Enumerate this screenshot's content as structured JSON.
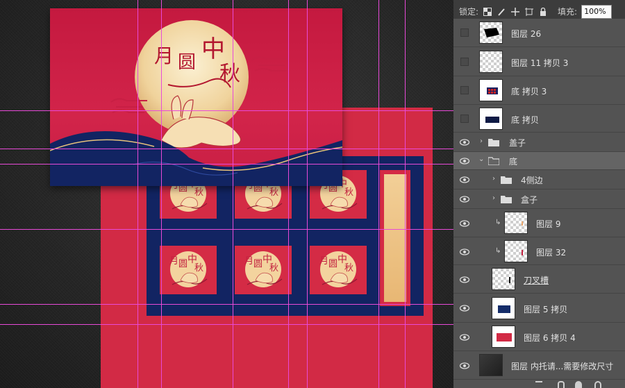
{
  "canvas": {
    "colors": {
      "red": "#d22a45",
      "navy": "#122462",
      "gold": "#f2cf97",
      "guide": "#e84ad8"
    },
    "lid_title": {
      "char1": "月",
      "char2": "圆",
      "char3": "中",
      "char4": "秋"
    },
    "cell_title": {
      "char1": "月",
      "char2": "圆",
      "char3": "中",
      "char4": "秋"
    }
  },
  "panel": {
    "toolbar": {
      "lock_label": "锁定:",
      "fill_label": "填充:",
      "fill_value": "100%"
    },
    "layers": [
      {
        "name": "图层 26"
      },
      {
        "name": "图层 11 拷贝 3"
      },
      {
        "name": "底 拷贝 3"
      },
      {
        "name": "底 拷贝"
      },
      {
        "name": "盖子"
      },
      {
        "name": "底"
      },
      {
        "name": "4侧边"
      },
      {
        "name": "盒子"
      },
      {
        "name": "图层 9"
      },
      {
        "name": "图层 32"
      },
      {
        "name": "刀叉槽"
      },
      {
        "name": "图层 5 拷贝"
      },
      {
        "name": "图层 6 拷贝 4"
      },
      {
        "name": "图层   内托请...需要修改尺寸"
      }
    ]
  }
}
